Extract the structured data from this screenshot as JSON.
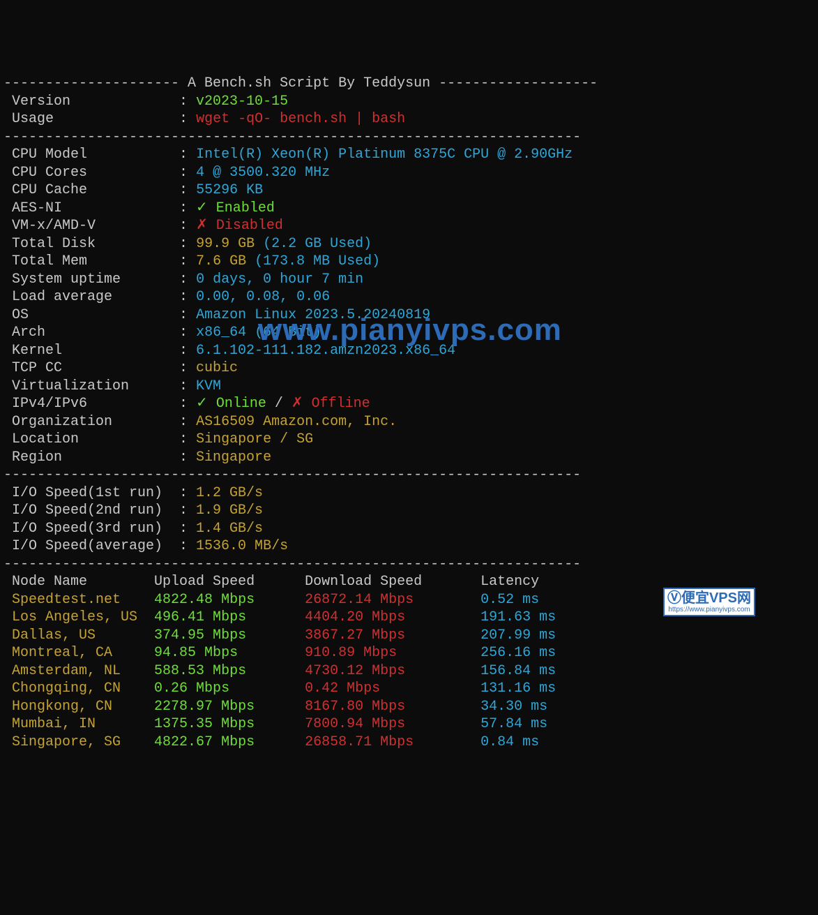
{
  "header": {
    "title_prefix": "--------------------- ",
    "title": "A Bench.sh Script By Teddysun",
    "title_suffix": " -------------------",
    "version_label": " Version",
    "version_pad": "             : ",
    "version_value": "v2023-10-15",
    "usage_label": " Usage",
    "usage_pad": "               : ",
    "usage_value": "wget -qO- bench.sh | bash"
  },
  "divider": "---------------------------------------------------------------------",
  "info": [
    {
      "label": " CPU Model",
      "pad": "           : ",
      "val": "Intel(R) Xeon(R) Platinum 8375C CPU @ 2.90GHz",
      "cls": "cyan"
    },
    {
      "label": " CPU Cores",
      "pad": "           : ",
      "val": "4 @ 3500.320 MHz",
      "cls": "cyan"
    },
    {
      "label": " CPU Cache",
      "pad": "           : ",
      "val": "55296 KB",
      "cls": "cyan"
    },
    {
      "label": " AES-NI",
      "pad": "              : ",
      "val": "✓ Enabled",
      "cls": "green"
    },
    {
      "label": " VM-x/AMD-V",
      "pad": "          : ",
      "val": "✗ Disabled",
      "cls": "red"
    },
    {
      "label": " Total Disk",
      "pad": "          : ",
      "val": "99.9 GB ",
      "cls": "yellow",
      "val2": "(2.2 GB Used)",
      "cls2": "cyan"
    },
    {
      "label": " Total Mem",
      "pad": "           : ",
      "val": "7.6 GB ",
      "cls": "yellow",
      "val2": "(173.8 MB Used)",
      "cls2": "cyan"
    },
    {
      "label": " System uptime",
      "pad": "       : ",
      "val": "0 days, 0 hour 7 min",
      "cls": "cyan"
    },
    {
      "label": " Load average",
      "pad": "        : ",
      "val": "0.00, 0.08, 0.06",
      "cls": "cyan"
    },
    {
      "label": " OS",
      "pad": "                  : ",
      "val": "Amazon Linux 2023.5.20240819",
      "cls": "cyan"
    },
    {
      "label": " Arch",
      "pad": "                : ",
      "val": "x86_64 (64 Bit)",
      "cls": "cyan"
    },
    {
      "label": " Kernel",
      "pad": "              : ",
      "val": "6.1.102-111.182.amzn2023.x86_64",
      "cls": "cyan"
    },
    {
      "label": " TCP CC",
      "pad": "              : ",
      "val": "cubic",
      "cls": "yellow"
    },
    {
      "label": " Virtualization",
      "pad": "      : ",
      "val": "KVM",
      "cls": "cyan"
    },
    {
      "label": " IPv4/IPv6",
      "pad": "           : ",
      "val": "✓ Online",
      "cls": "green",
      "sep": " / ",
      "val2": "✗ Offline",
      "cls2": "red"
    },
    {
      "label": " Organization",
      "pad": "        : ",
      "val": "AS16509 Amazon.com, Inc.",
      "cls": "yellow"
    },
    {
      "label": " Location",
      "pad": "            : ",
      "val": "Singapore / SG",
      "cls": "yellow"
    },
    {
      "label": " Region",
      "pad": "              : ",
      "val": "Singapore",
      "cls": "yellow"
    }
  ],
  "io": [
    {
      "label": " I/O Speed(1st run)  : ",
      "val": "1.2 GB/s",
      "cls": "yellow"
    },
    {
      "label": " I/O Speed(2nd run)  : ",
      "val": "1.9 GB/s",
      "cls": "yellow"
    },
    {
      "label": " I/O Speed(3rd run)  : ",
      "val": "1.4 GB/s",
      "cls": "yellow"
    },
    {
      "label": " I/O Speed(average)  : ",
      "val": "1536.0 MB/s",
      "cls": "yellow"
    }
  ],
  "speed_header": {
    "node": " Node Name        ",
    "upload": "Upload Speed      ",
    "download": "Download Speed       ",
    "latency": "Latency"
  },
  "speed_rows": [
    {
      "node": " Speedtest.net    ",
      "up": "4822.48 Mbps      ",
      "dn": "26872.14 Mbps        ",
      "lat": "0.52 ms"
    },
    {
      "node": " Los Angeles, US  ",
      "up": "496.41 Mbps       ",
      "dn": "4404.20 Mbps         ",
      "lat": "191.63 ms"
    },
    {
      "node": " Dallas, US       ",
      "up": "374.95 Mbps       ",
      "dn": "3867.27 Mbps         ",
      "lat": "207.99 ms"
    },
    {
      "node": " Montreal, CA     ",
      "up": "94.85 Mbps        ",
      "dn": "910.89 Mbps          ",
      "lat": "256.16 ms"
    },
    {
      "node": " Amsterdam, NL    ",
      "up": "588.53 Mbps       ",
      "dn": "4730.12 Mbps         ",
      "lat": "156.84 ms"
    },
    {
      "node": " Chongqing, CN    ",
      "up": "0.26 Mbps         ",
      "dn": "0.42 Mbps            ",
      "lat": "131.16 ms"
    },
    {
      "node": " Hongkong, CN     ",
      "up": "2278.97 Mbps      ",
      "dn": "8167.80 Mbps         ",
      "lat": "34.30 ms"
    },
    {
      "node": " Mumbai, IN       ",
      "up": "1375.35 Mbps      ",
      "dn": "7800.94 Mbps         ",
      "lat": "57.84 ms"
    },
    {
      "node": " Singapore, SG    ",
      "up": "4822.67 Mbps      ",
      "dn": "26858.71 Mbps        ",
      "lat": "0.84 ms"
    }
  ],
  "watermark": "www.pianyivps.com",
  "badge": {
    "logo": "Ⓥ",
    "name": "便宜VPS网",
    "url": "https://www.pianyivps.com"
  }
}
